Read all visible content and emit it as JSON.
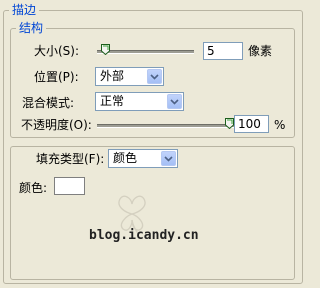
{
  "panel": {
    "title": "描边",
    "structure": {
      "title": "结构",
      "size": {
        "label": "大小(S):",
        "value": "5",
        "unit": "像素",
        "level": 0.04
      },
      "position": {
        "label": "位置(P):",
        "value": "外部"
      },
      "blend_mode": {
        "label": "混合模式:",
        "value": "正常"
      },
      "opacity": {
        "label": "不透明度(O):",
        "value": "100",
        "unit": "%",
        "level": 1.0
      }
    },
    "fill": {
      "type_label": "填充类型(F):",
      "type_value": "颜色",
      "color_label": "颜色:",
      "color_value": "#ffffff"
    }
  },
  "watermark": {
    "text": "blog.icandy.cn"
  },
  "colors": {
    "background": "#ece9d8",
    "group_title": "#0046d5",
    "border": "#b8b4a2"
  }
}
